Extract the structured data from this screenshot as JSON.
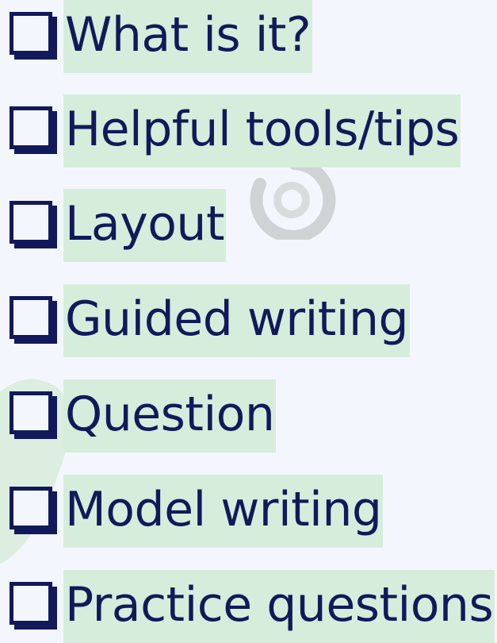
{
  "checklist": {
    "items": [
      {
        "label": "What is it?"
      },
      {
        "label": "Helpful tools/tips"
      },
      {
        "label": "Layout"
      },
      {
        "label": "Guided writing"
      },
      {
        "label": "Question"
      },
      {
        "label": "Model writing"
      },
      {
        "label": "Practice questions"
      }
    ]
  },
  "colors": {
    "text": "#12195b",
    "highlight": "#d6eddb",
    "background": "#f3f7fd"
  },
  "icons": {
    "checkbox": "checkbox-icon",
    "watermark": "circular-logo-watermark"
  }
}
